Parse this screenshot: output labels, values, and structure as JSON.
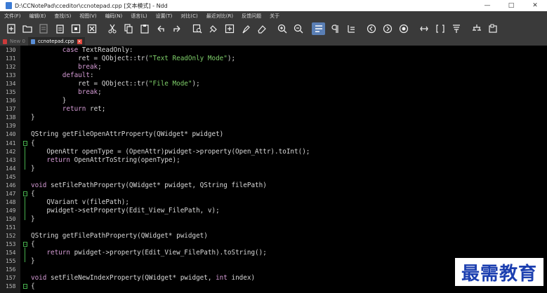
{
  "window": {
    "title": "D:\\CCNotePad\\cceditor\\ccnotepad.cpp [文本模式] - Ndd",
    "controls": [
      "—",
      "□",
      "✕"
    ]
  },
  "menu": {
    "items": [
      "文件(F)",
      "编辑(E)",
      "查找(S)",
      "视图(V)",
      "编码(N)",
      "语言(L)",
      "设置(T)",
      "对比(C)",
      "最近对比(R)",
      "反馈问题",
      "关于"
    ]
  },
  "toolbar": {
    "icons": [
      "new-file-icon",
      "open-folder-icon",
      "save-icon",
      "save-all-icon",
      "close-icon",
      "close-all-icon",
      "cut-icon",
      "copy-icon",
      "paste-icon",
      "undo-icon",
      "redo-icon",
      "find-icon",
      "replace-icon",
      "goto-icon",
      "mark-icon",
      "clear-mark-icon",
      "zoom-in-icon",
      "zoom-out-icon",
      "word-wrap-icon",
      "show-symbols-icon",
      "indent-guide-icon",
      "prev-icon",
      "next-icon",
      "record-icon",
      "compare-icon",
      "dir-compare-icon",
      "bin-compare-icon",
      "encoding-icon",
      "hex-icon"
    ]
  },
  "tabs": [
    {
      "label": "New 0",
      "active": false
    },
    {
      "label": "ccnotepad.cpp",
      "active": true
    }
  ],
  "code": {
    "lines": [
      {
        "n": "130",
        "fold": "",
        "segs": [
          [
            "        ",
            ""
          ],
          [
            "case",
            "kw"
          ],
          [
            " TextReadOnly:",
            ""
          ]
        ]
      },
      {
        "n": "131",
        "fold": "",
        "segs": [
          [
            "            ret = QObject::tr(",
            ""
          ],
          [
            "\"Text ReadOnly Mode\"",
            "str"
          ],
          [
            ");",
            ""
          ]
        ]
      },
      {
        "n": "132",
        "fold": "",
        "segs": [
          [
            "            ",
            ""
          ],
          [
            "break",
            "kw"
          ],
          [
            ";",
            ""
          ]
        ]
      },
      {
        "n": "133",
        "fold": "",
        "segs": [
          [
            "        ",
            ""
          ],
          [
            "default",
            "kw"
          ],
          [
            ":",
            ""
          ]
        ]
      },
      {
        "n": "134",
        "fold": "",
        "segs": [
          [
            "            ret = QObject::tr(",
            ""
          ],
          [
            "\"File Mode\"",
            "str"
          ],
          [
            ");",
            ""
          ]
        ]
      },
      {
        "n": "135",
        "fold": "",
        "segs": [
          [
            "            ",
            ""
          ],
          [
            "break",
            "kw"
          ],
          [
            ";",
            ""
          ]
        ]
      },
      {
        "n": "136",
        "fold": "",
        "segs": [
          [
            "        }",
            ""
          ]
        ]
      },
      {
        "n": "137",
        "fold": "",
        "segs": [
          [
            "        ",
            ""
          ],
          [
            "return",
            "kw"
          ],
          [
            " ret;",
            ""
          ]
        ]
      },
      {
        "n": "138",
        "fold": "",
        "segs": [
          [
            "}",
            ""
          ]
        ]
      },
      {
        "n": "139",
        "fold": "",
        "segs": []
      },
      {
        "n": "140",
        "fold": "",
        "segs": [
          [
            "QString getFileOpenAttrProperty(QWidget* pwidget)",
            ""
          ]
        ]
      },
      {
        "n": "141",
        "fold": "−",
        "segs": [
          [
            "{",
            ""
          ]
        ]
      },
      {
        "n": "142",
        "fold": "",
        "segs": [
          [
            "    OpenAttr openType = (OpenAttr)pwidget->property(Open_Attr).toInt();",
            ""
          ]
        ]
      },
      {
        "n": "143",
        "fold": "",
        "segs": [
          [
            "    ",
            ""
          ],
          [
            "return",
            "kw"
          ],
          [
            " OpenAttrToString(openType);",
            ""
          ]
        ]
      },
      {
        "n": "144",
        "fold": "",
        "segs": [
          [
            "}",
            ""
          ]
        ]
      },
      {
        "n": "145",
        "fold": "",
        "segs": []
      },
      {
        "n": "146",
        "fold": "",
        "segs": [
          [
            "void",
            "kw"
          ],
          [
            " setFilePathProperty(QWidget* pwidget, QString filePath)",
            ""
          ]
        ]
      },
      {
        "n": "147",
        "fold": "−",
        "segs": [
          [
            "{",
            ""
          ]
        ]
      },
      {
        "n": "148",
        "fold": "",
        "segs": [
          [
            "    QVariant v(filePath);",
            ""
          ]
        ]
      },
      {
        "n": "149",
        "fold": "",
        "segs": [
          [
            "    pwidget->setProperty(Edit_View_FilePath, v);",
            ""
          ]
        ]
      },
      {
        "n": "150",
        "fold": "",
        "segs": [
          [
            "}",
            ""
          ]
        ]
      },
      {
        "n": "151",
        "fold": "",
        "segs": []
      },
      {
        "n": "152",
        "fold": "",
        "segs": [
          [
            "QString getFilePathProperty(QWidget* pwidget)",
            ""
          ]
        ]
      },
      {
        "n": "153",
        "fold": "−",
        "segs": [
          [
            "{",
            ""
          ]
        ]
      },
      {
        "n": "154",
        "fold": "",
        "segs": [
          [
            "    ",
            ""
          ],
          [
            "return",
            "kw"
          ],
          [
            " pwidget->property(Edit_View_FilePath).toString();",
            ""
          ]
        ]
      },
      {
        "n": "155",
        "fold": "",
        "segs": [
          [
            "}",
            ""
          ]
        ]
      },
      {
        "n": "156",
        "fold": "",
        "segs": []
      },
      {
        "n": "157",
        "fold": "",
        "segs": [
          [
            "void",
            "kw"
          ],
          [
            " setFileNewIndexProperty(QWidget* pwidget, ",
            ""
          ],
          [
            "int",
            "kw"
          ],
          [
            " index)",
            ""
          ]
        ]
      },
      {
        "n": "158",
        "fold": "−",
        "segs": [
          [
            "{",
            ""
          ]
        ]
      }
    ]
  },
  "watermark": {
    "text": "最需教育"
  },
  "colors": {
    "background": "#000000",
    "keyword": "#d59bd5",
    "string": "#7fd06a",
    "text": "#d9d9d9",
    "fold_marker": "#47b04e",
    "chrome": "#3a3a3a",
    "watermark": "#1c3fb0"
  }
}
